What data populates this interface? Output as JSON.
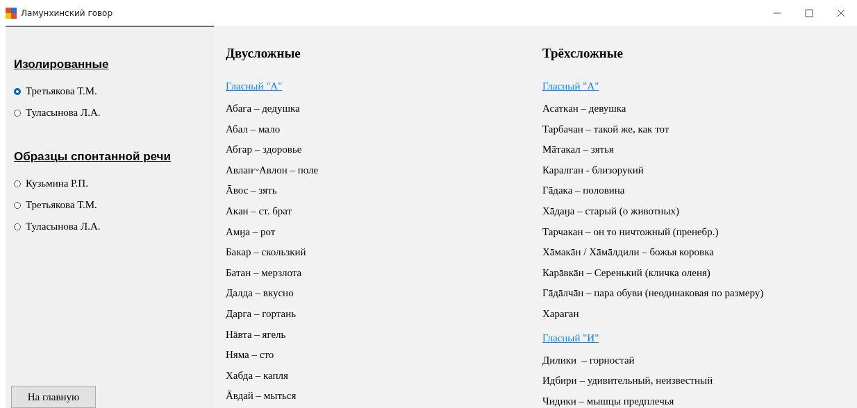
{
  "window": {
    "title": "Ламунхинский говор"
  },
  "sidebar": {
    "groups": [
      {
        "title": "Изолированные",
        "options": [
          {
            "label": "Третьякова Т.М.",
            "selected": true
          },
          {
            "label": "Туласынова Л.А.",
            "selected": false
          }
        ]
      },
      {
        "title": "Образцы спонтанной речи",
        "options": [
          {
            "label": "Кузьмина Р.П.",
            "selected": false
          },
          {
            "label": "Третьякова Т.М.",
            "selected": false
          },
          {
            "label": "Туласынова Л.А.",
            "selected": false
          }
        ]
      }
    ],
    "home_button": "На главную"
  },
  "columns": [
    {
      "title": "Двусложные",
      "sections": [
        {
          "link": "Гласный \"А\"",
          "words": [
            "Абага – дедушка",
            "Абал – мало",
            "Абгар – здоровье",
            "Авлан~Авлон – поле",
            "Āвос – зять",
            "Акан – ст. брат",
            "Амӈа – рот",
            "Бакар – скользкий",
            "Батан – мерзлота",
            "Далда – вкусно",
            "Дарга – гортань",
            "Нāвта – ягель",
            "Няма – сто",
            "Хабда – капля",
            "Āвдай – мыться"
          ]
        }
      ]
    },
    {
      "title": "Трёхсложные",
      "sections": [
        {
          "link": "Гласный \"А\"",
          "words": [
            "Асаткан – девушка",
            "Тарбачан – такой же, как тот",
            "Мāтакал – зятья",
            "Каралган - близорукий",
            "Гāдака – половина",
            "Хāдаӈа – старый (о животных)",
            "Тарчакан – он то ничтожный (пренебр.)",
            "Хāмакāн / Хāмāлдили – божья коровка",
            "Карāвкāн – Серенький (кличка оленя)",
            "Гāдāлчāн – пара обуви (неодинаковая по размеру)",
            "Хараган"
          ]
        },
        {
          "link": "Гласный \"И\"",
          "words": [
            "Дилики  – горностай",
            "Идбири – удивительный, неизвестный",
            "Чидики – мышцы предплечья"
          ]
        }
      ]
    }
  ]
}
